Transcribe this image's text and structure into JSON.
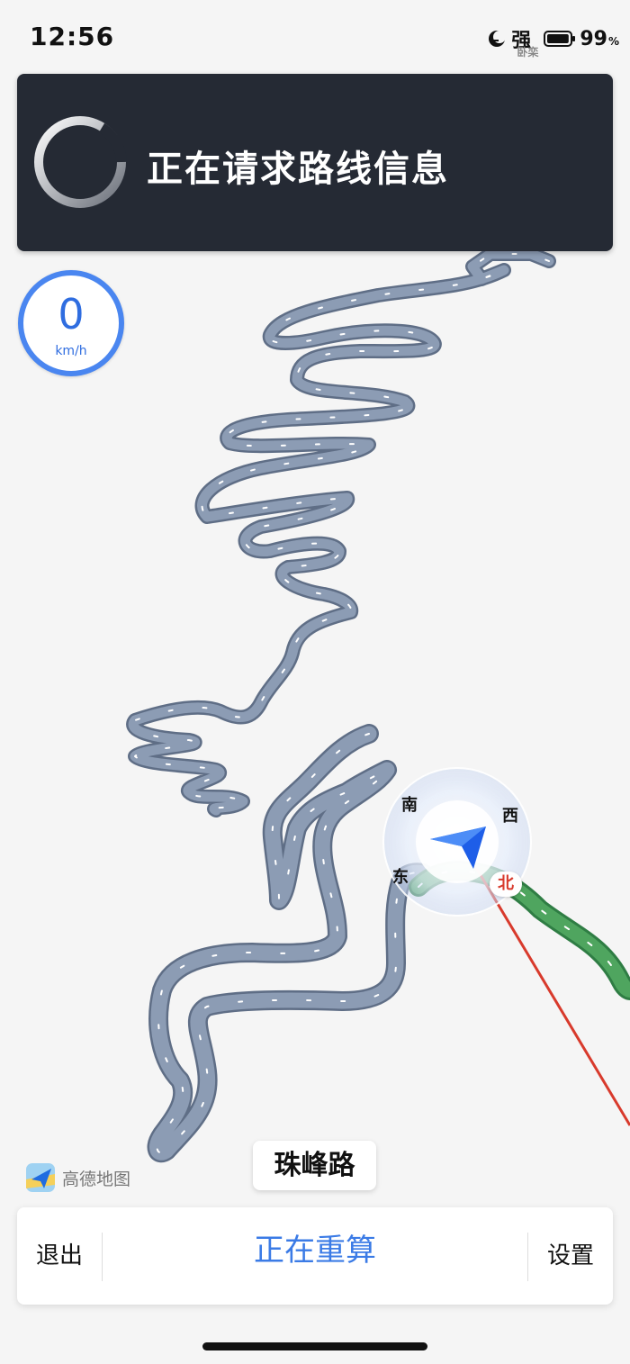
{
  "status_bar": {
    "time": "12:56",
    "signal_label": "强",
    "signal_sublabel": "卧栾",
    "battery_percent": "99",
    "battery_unit": "%",
    "battery_level": 0.99,
    "icons": [
      "moon-icon",
      "battery-icon"
    ]
  },
  "banner": {
    "message": "正在请求路线信息",
    "icon": "spinner-icon"
  },
  "speed": {
    "value": "0",
    "unit": "km/h",
    "accent": "#4a86f0"
  },
  "compass": {
    "south": "南",
    "west": "西",
    "east": "东",
    "north": "北",
    "north_color": "#d83a2c"
  },
  "map": {
    "road_color": "#8c9cb4",
    "active_route_color": "#4fa55f",
    "heading_line_color": "#d83a2c",
    "logo_text": "高德地图",
    "current_road": "珠峰路"
  },
  "bottom_bar": {
    "exit_label": "退出",
    "status_label": "正在重算",
    "settings_label": "设置"
  }
}
